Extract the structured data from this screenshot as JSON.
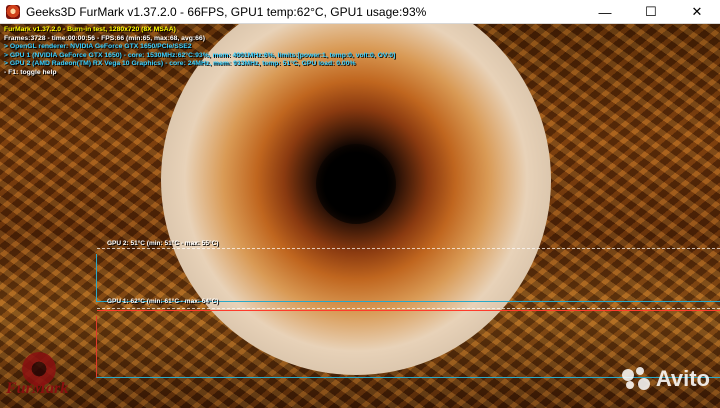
{
  "window": {
    "title": "Geeks3D FurMark v1.37.2.0 - 66FPS, GPU1 temp:62°C, GPU1 usage:93%",
    "controls": {
      "minimize": "—",
      "maximize": "☐",
      "close": "✕"
    }
  },
  "osd": {
    "line1": "FurMark v1.37.2.0 - Burn-in test, 1280x720 (8X MSAA)",
    "line2": "Frames:3728 - time:00:00:56 - FPS:66 (min:65, max:68, avg:66)",
    "line3": "> OpenGL renderer: NVIDIA GeForce GTX 1650/PCIe/SSE2",
    "line4": "> GPU 1 (NVIDIA GeForce GTX 1650) - core: 1530MHz:62°C:93%, mem: 4001MHz:6%, limits:[power:1, temp:0, volt:0, OV:0]",
    "line5": "> GPU 2 (AMD Radeon(TM) RX Vega 10 Graphics) - core: 24MHz, mem: 933MHz, temp: 51°C, GPU load: 0.00%",
    "line6": "- F1: toggle help"
  },
  "graphs": {
    "gpu2": {
      "label": "GPU 2: 51°C (min: 51°C - max: 55°C)",
      "color": "#2aa8c8"
    },
    "gpu1": {
      "label": "GPU 1: 62°C (min: 61°C - max: 64°C)",
      "color": "#ff3b2b"
    }
  },
  "logo": {
    "text": "FurMark"
  },
  "watermark": {
    "text": "Avito"
  }
}
